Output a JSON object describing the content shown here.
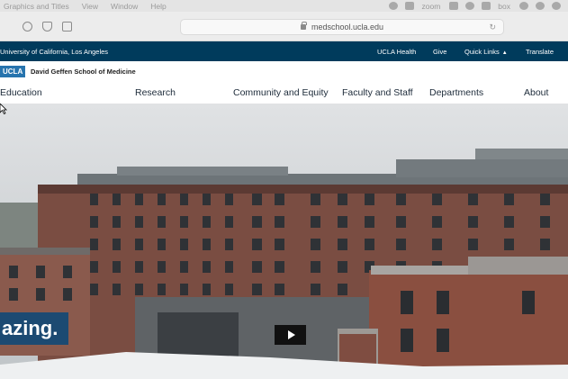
{
  "menubar": {
    "items": [
      "Graphics and Titles",
      "View",
      "Window",
      "Help"
    ],
    "tray_icons": [
      "sync-icon",
      "notes-icon",
      "zoom-app",
      "scissors-icon",
      "timer-icon",
      "dropbox-icon",
      "box-app",
      "account-icon",
      "globe-icon",
      "cloud-icon"
    ],
    "zoom_label": "zoom",
    "box_label": "box"
  },
  "browser": {
    "url": "medschool.ucla.edu"
  },
  "topbar": {
    "university": "University of California, Los Angeles",
    "links": [
      "UCLA Health",
      "Give",
      "Quick Links",
      "Translate"
    ]
  },
  "brand": {
    "logo": "UCLA",
    "school": "David Geffen School of Medicine"
  },
  "nav": {
    "items": [
      "Education",
      "Research",
      "Community and Equity",
      "Faculty and Staff",
      "Departments",
      "About"
    ]
  },
  "hero": {
    "caption": "azing.",
    "colors": {
      "caption_bg": "#1c4a72",
      "brand_blue": "#003b5c",
      "logo_blue": "#2774ae"
    }
  }
}
